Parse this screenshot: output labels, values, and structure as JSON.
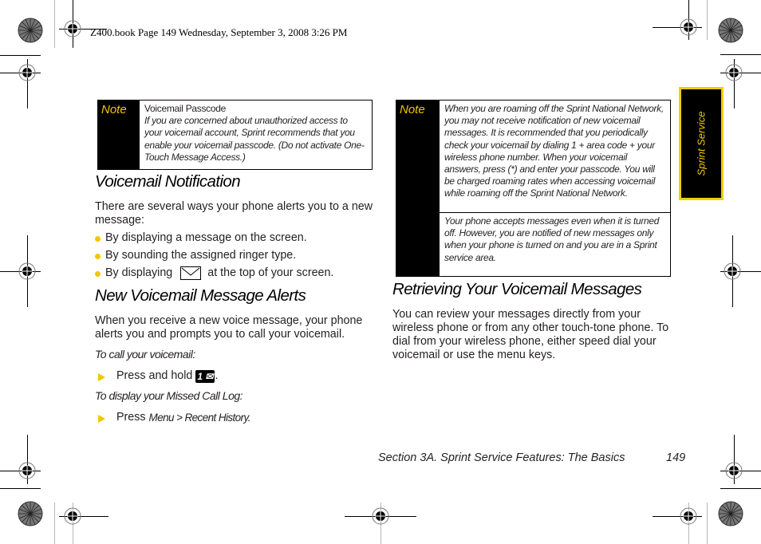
{
  "slug": "Z400.book  Page 149  Wednesday, September 3, 2008  3:26 PM",
  "side_tab": "Sprint Service",
  "left_note": {
    "label": "Note",
    "title": "Voicemail Passcode",
    "text": "If you are concerned about unauthorized access to your voicemail account, Sprint recommends that you enable your voicemail passcode. (Do not activate One-Touch Message Access.)"
  },
  "voicemail_notification": {
    "heading": "Voicemail Notification",
    "intro": "There are several ways your phone alerts you to a new message:",
    "bullets": [
      "By displaying a message on the screen.",
      "By sounding the assigned ringer type.",
      "By displaying",
      "at the top of your screen."
    ],
    "bullet_icon": "envelope-icon"
  },
  "new_alerts": {
    "heading": "New Voicemail Message Alerts",
    "text": "When you receive a new voice message, your phone alerts you and prompts you to call your voicemail.",
    "call_label": "To call your voicemail:",
    "call_step_prefix": "Press and hold",
    "call_key": "1 ✉",
    "call_step_suffix": ".",
    "missed_label": "To display your Missed Call Log:",
    "missed_step_prefix": "Press",
    "missed_menu": "Menu > Recent History."
  },
  "right_note": {
    "label": "Note",
    "text1": "When you are roaming off the Sprint National Network, you may not receive notification of new voicemail messages. It is recommended that you periodically check your voicemail by dialing 1 + area code + your wireless phone number. When your voicemail answers, press (*) and enter your passcode. You will be charged roaming rates when accessing voicemail while roaming off the Sprint National Network.",
    "text2": "Your phone accepts messages even when it is turned off. However, you are notified of new messages only when your phone is turned on and you are in a Sprint service area."
  },
  "retrieving": {
    "heading": "Retrieving Your Voicemail Messages",
    "text": "You can review your messages directly from your wireless phone or from any other touch-tone phone. To dial from your wireless phone, either speed dial your voicemail or use the menu keys."
  },
  "footer": {
    "section": "Section 3A. Sprint Service Features: The Basics",
    "page": "149"
  },
  "colors": {
    "accent": "#f2c600",
    "text": "#231f20"
  }
}
